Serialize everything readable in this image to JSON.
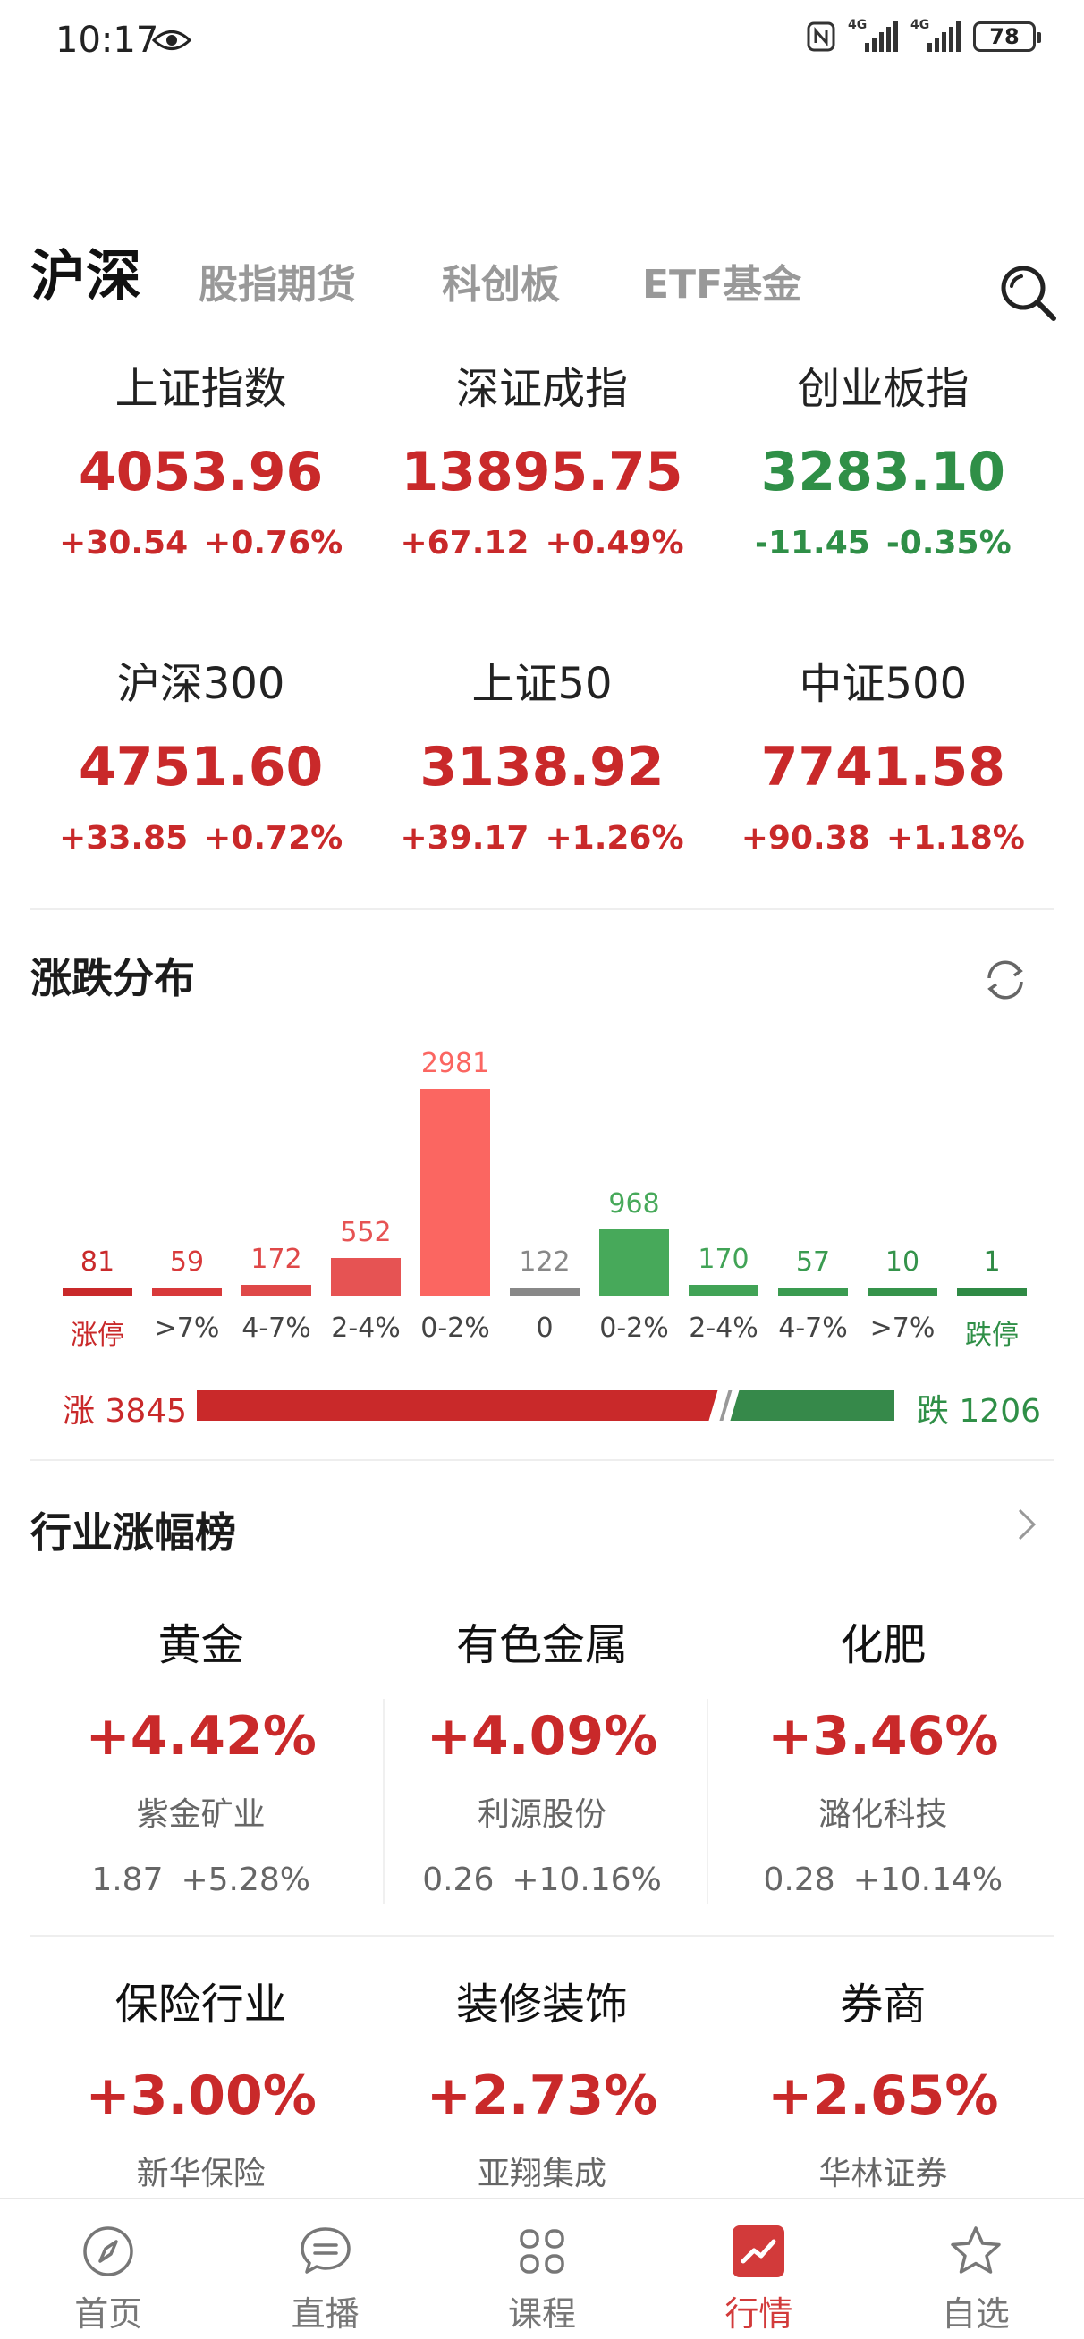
{
  "status": {
    "time": "10:17",
    "net1": "4G",
    "net2": "4G",
    "battery": "78"
  },
  "tabs": [
    {
      "label": "沪深",
      "active": true
    },
    {
      "label": "股指期货",
      "active": false
    },
    {
      "label": "科创板",
      "active": false
    },
    {
      "label": "ETF基金",
      "active": false
    }
  ],
  "indices": [
    {
      "name": "上证指数",
      "value": "4053.96",
      "change": "+30.54",
      "pct": "+0.76%",
      "dir": "up"
    },
    {
      "name": "深证成指",
      "value": "13895.75",
      "change": "+67.12",
      "pct": "+0.49%",
      "dir": "up"
    },
    {
      "name": "创业板指",
      "value": "3283.10",
      "change": "-11.45",
      "pct": "-0.35%",
      "dir": "down"
    },
    {
      "name": "沪深300",
      "value": "4751.60",
      "change": "+33.85",
      "pct": "+0.72%",
      "dir": "up"
    },
    {
      "name": "上证50",
      "value": "3138.92",
      "change": "+39.17",
      "pct": "+1.26%",
      "dir": "up"
    },
    {
      "name": "中证500",
      "value": "7741.58",
      "change": "+90.38",
      "pct": "+1.18%",
      "dir": "up"
    }
  ],
  "distribution": {
    "title": "涨跌分布",
    "buckets": [
      {
        "label": "涨停",
        "count": 81,
        "color": "#c9292a",
        "label_color": "#c9292a"
      },
      {
        "label": ">7%",
        "count": 59,
        "color": "#d8393a",
        "label_color": "#444444"
      },
      {
        "label": "4-7%",
        "count": 172,
        "color": "#df4848",
        "label_color": "#444444"
      },
      {
        "label": "2-4%",
        "count": 552,
        "color": "#e65353",
        "label_color": "#444444"
      },
      {
        "label": "0-2%",
        "count": 2981,
        "color": "#fb6661",
        "label_color": "#444444"
      },
      {
        "label": "0",
        "count": 122,
        "color": "#888888",
        "label_color": "#444444"
      },
      {
        "label": "0-2%",
        "count": 968,
        "color": "#47a95a",
        "label_color": "#444444"
      },
      {
        "label": "2-4%",
        "count": 170,
        "color": "#41a356",
        "label_color": "#444444"
      },
      {
        "label": "4-7%",
        "count": 57,
        "color": "#3a9b50",
        "label_color": "#444444"
      },
      {
        "label": ">7%",
        "count": 10,
        "color": "#35934b",
        "label_color": "#444444"
      },
      {
        "label": "跌停",
        "count": 1,
        "color": "#2f8a45",
        "label_color": "#2f8f47"
      }
    ],
    "up_label": "涨 3845",
    "down_label": "跌 1206",
    "up_total": 3845,
    "down_total": 1206,
    "up_color": "#c9292a",
    "down_color": "#36894a"
  },
  "industry": {
    "title": "行业涨幅榜",
    "items": [
      {
        "name": "黄金",
        "pct": "+4.42%",
        "stock": "紫金矿业",
        "price": "1.87",
        "stock_pct": "+5.28%"
      },
      {
        "name": "有色金属",
        "pct": "+4.09%",
        "stock": "利源股份",
        "price": "0.26",
        "stock_pct": "+10.16%"
      },
      {
        "name": "化肥",
        "pct": "+3.46%",
        "stock": "潞化科技",
        "price": "0.28",
        "stock_pct": "+10.14%"
      },
      {
        "name": "保险行业",
        "pct": "+3.00%",
        "stock": "新华保险"
      },
      {
        "name": "装修装饰",
        "pct": "+2.73%",
        "stock": "亚翔集成"
      },
      {
        "name": "券商",
        "pct": "+2.65%",
        "stock": "华林证券"
      }
    ]
  },
  "nav": [
    {
      "label": "首页",
      "icon": "compass-icon",
      "active": false
    },
    {
      "label": "直播",
      "icon": "chat-icon",
      "active": false
    },
    {
      "label": "课程",
      "icon": "grid-icon",
      "active": false
    },
    {
      "label": "行情",
      "icon": "trend-icon",
      "active": true
    },
    {
      "label": "自选",
      "icon": "star-icon",
      "active": false
    }
  ]
}
